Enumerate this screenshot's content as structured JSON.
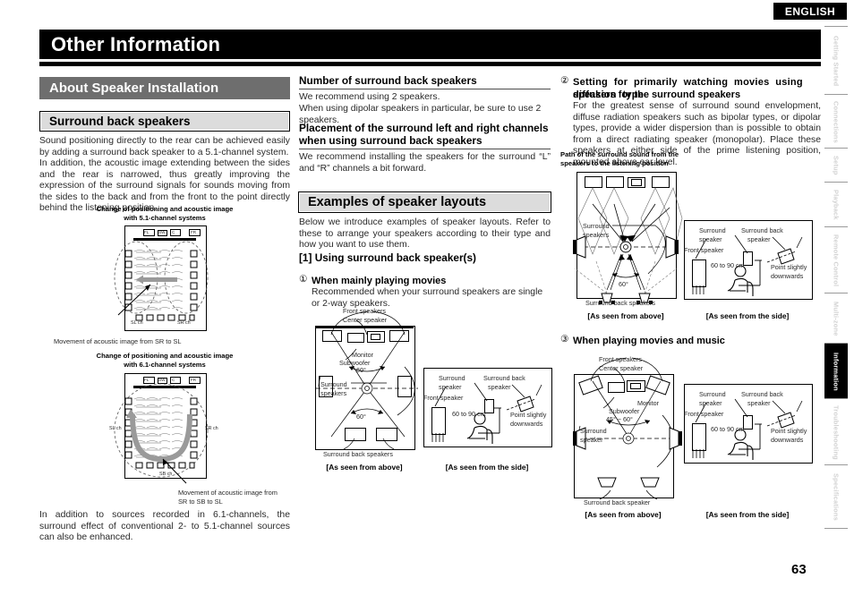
{
  "meta": {
    "language_badge": "ENGLISH",
    "page_number": "63"
  },
  "header": {
    "title": "Other Information"
  },
  "section": {
    "title": "About Speaker Installation"
  },
  "left_column": {
    "sub_head": "Surround back speakers",
    "paragraph_1": "Sound positioning directly to the rear can be achieved easily by adding a surround back speaker to a 5.1-channel system.",
    "paragraph_2": "In addition, the acoustic image extending between the sides and the rear is narrowed, thus greatly improving the expression of the surround signals for sounds moving from the sides to the back and from the front to the point directly behind the listening position.",
    "fig1_caption_line1": "Change of positioning and acoustic image",
    "fig1_caption_line2": "with 5.1-channel systems",
    "fig1_note": "Movement of acoustic image from SR to SL",
    "fig1_labels": {
      "fl": "FL",
      "sw": "SW",
      "c": "C",
      "fr": "FR",
      "sl": "SL ch",
      "sr": "SR ch"
    },
    "fig2_caption_line1": "Change of positioning and acoustic image",
    "fig2_caption_line2": "with 6.1-channel systems",
    "fig2_note_line1": "Movement of acoustic image from",
    "fig2_note_line2": "SR to SB to SL",
    "fig2_labels": {
      "fl": "FL",
      "sw": "SW",
      "c": "C",
      "fr": "FR",
      "sl": "SL ch",
      "sr": "SR ch",
      "sb": "SB ch"
    },
    "paragraph_3": "In addition to sources recorded in 6.1-channels, the surround effect of conventional 2- to 5.1-channel sources can also be enhanced."
  },
  "middle_column": {
    "head_1": "Number of surround back speakers",
    "body_1_line1": "We recommend using 2 speakers.",
    "body_1_line2": "When using dipolar speakers in particular, be sure to use 2 speakers.",
    "head_2_line1": "Placement of the surround left and right channels",
    "head_2_line2": "when using surround back speakers",
    "body_2": "We recommend installing the speakers for the surround “L” and “R” channels a bit forward.",
    "sub_head": "Examples of speaker layouts",
    "body_3": "Below we introduce examples of speaker layouts. Refer to these to arrange your speakers according to their type and how you want to use them.",
    "list_head": "[1] Using surround back speaker(s)",
    "item1_number": "①",
    "item1_title": "When mainly playing movies",
    "item1_body": "Recommended when your surround speakers are single or 2-way speakers.",
    "fig_top": {
      "label_front": "Front speakers",
      "label_center": "Center speaker",
      "label_monitor": "Monitor",
      "label_subwoofer": "Subwoofer",
      "label_surround_line1": "Surround",
      "label_surround_line2": "speakers",
      "angle_top": "60°",
      "angle_bottom": "60°",
      "label_surround_back": "Surround back speakers",
      "caption": "[As seen from above]"
    },
    "fig_side": {
      "label_surround_line1": "Surround",
      "label_surround_line2": "speaker",
      "label_surround_back_line1": "Surround back",
      "label_surround_back_line2": "speaker",
      "label_front": "Front speaker",
      "label_height": "60 to 90 cm",
      "label_point_line1": "Point slightly",
      "label_point_line2": "downwards",
      "caption": "[As seen from the side]"
    }
  },
  "right_column": {
    "item2_number": "②",
    "item2_title_line1": "Setting for primarily watching movies using diffusion type",
    "item2_title_line2": "speakers for the surround speakers",
    "item2_body": "For the greatest sense of surround sound envelopment, diffuse radiation speakers such as bipolar types, or dipolar types, provide a wider dispersion than is possible to obtain from a direct radiating speaker (monopolar). Place these speakers at either side of the prime listening position, mounted above ear level.",
    "fig_caption_line1": "Path of the surround sound from the",
    "fig_caption_line2": "speakers to the listening position",
    "fig_top": {
      "label_surround_line1": "Surround",
      "label_surround_line2": "speakers",
      "angle": "60°",
      "label_surround_back": "Surround back speakers",
      "caption": "[As seen from above]"
    },
    "fig_side": {
      "label_surround_line1": "Surround",
      "label_surround_line2": "speaker",
      "label_surround_back_line1": "Surround back",
      "label_surround_back_line2": "speaker",
      "label_front": "Front speaker",
      "label_height": "60 to 90 cm",
      "label_point_line1": "Point slightly",
      "label_point_line2": "downwards",
      "caption": "[As seen from the side]"
    },
    "item3_number": "③",
    "item3_title": "When playing movies and music",
    "fig3_top": {
      "label_front": "Front speakers",
      "label_center": "Center speaker",
      "label_monitor": "Monitor",
      "label_subwoofer": "Subwoofer",
      "label_surround_line1": "Surround",
      "label_surround_line2": "speaker",
      "angle": "45° ~ 60°",
      "label_surround_back": "Surround back speaker",
      "caption": "[As seen from above]"
    },
    "fig3_side": {
      "label_surround_line1": "Surround",
      "label_surround_line2": "speaker",
      "label_surround_back_line1": "Surround back",
      "label_surround_back_line2": "speaker",
      "label_front": "Front speaker",
      "label_height": "60 to 90 cm",
      "label_point_line1": "Point slightly",
      "label_point_line2": "downwards",
      "caption": "[As seen from the side]"
    }
  },
  "tabs": [
    {
      "label": "Getting Started",
      "active": false
    },
    {
      "label": "Connections",
      "active": false
    },
    {
      "label": "Setup",
      "active": false
    },
    {
      "label": "Playback",
      "active": false
    },
    {
      "label": "Remote Control",
      "active": false
    },
    {
      "label": "Multi-zone",
      "active": false
    },
    {
      "label": "Information",
      "active": true
    },
    {
      "label": "Troubleshooting",
      "active": false
    },
    {
      "label": "Specifications",
      "active": false
    }
  ]
}
